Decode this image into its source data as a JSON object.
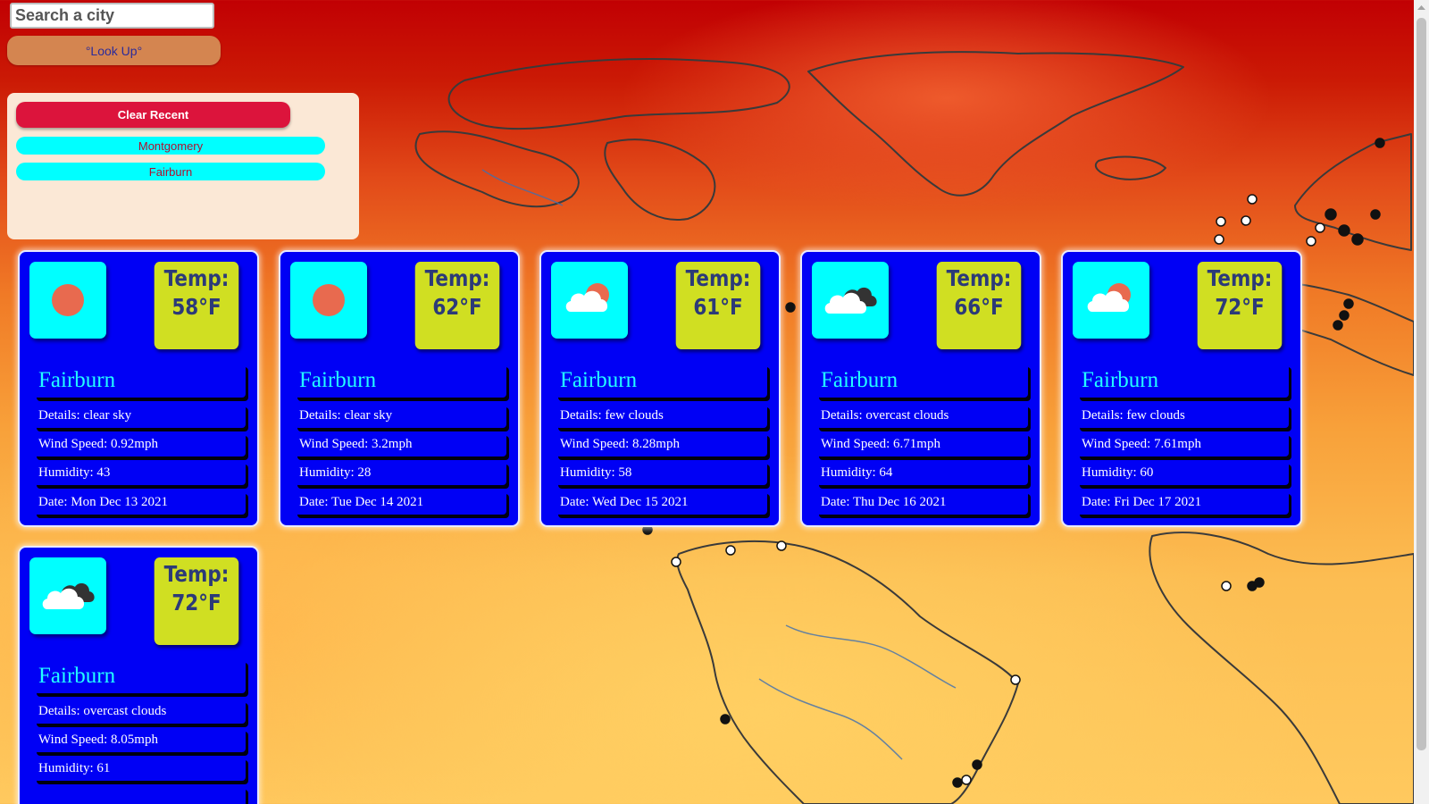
{
  "search": {
    "placeholder": "Search a city",
    "button_label": "°Look Up°"
  },
  "recent": {
    "clear_label": "Clear Recent",
    "cities": [
      "Montgomery",
      "Fairburn"
    ]
  },
  "forecast": [
    {
      "icon": "sun-icon",
      "temp_label": "Temp:",
      "temp": "58°F",
      "city": "Fairburn",
      "details": "Details: clear sky",
      "wind": "Wind Speed: 0.92mph",
      "humidity": "Humidity: 43",
      "date": "Date: Mon Dec 13 2021"
    },
    {
      "icon": "sun-icon",
      "temp_label": "Temp:",
      "temp": "62°F",
      "city": "Fairburn",
      "details": "Details: clear sky",
      "wind": "Wind Speed: 3.2mph",
      "humidity": "Humidity: 28",
      "date": "Date: Tue Dec 14 2021"
    },
    {
      "icon": "few-clouds-icon",
      "temp_label": "Temp:",
      "temp": "61°F",
      "city": "Fairburn",
      "details": "Details: few clouds",
      "wind": "Wind Speed: 8.28mph",
      "humidity": "Humidity: 58",
      "date": "Date: Wed Dec 15 2021"
    },
    {
      "icon": "overcast-clouds-icon",
      "temp_label": "Temp:",
      "temp": "66°F",
      "city": "Fairburn",
      "details": "Details: overcast clouds",
      "wind": "Wind Speed: 6.71mph",
      "humidity": "Humidity: 64",
      "date": "Date: Thu Dec 16 2021"
    },
    {
      "icon": "few-clouds-icon",
      "temp_label": "Temp:",
      "temp": "72°F",
      "city": "Fairburn",
      "details": "Details: few clouds",
      "wind": "Wind Speed: 7.61mph",
      "humidity": "Humidity: 60",
      "date": "Date: Fri Dec 17 2021"
    },
    {
      "icon": "overcast-clouds-icon",
      "temp_label": "Temp:",
      "temp": "72°F",
      "city": "Fairburn",
      "details": "Details: overcast clouds",
      "wind": "Wind Speed: 8.05mph",
      "humidity": "Humidity: 61",
      "date": ""
    }
  ],
  "colors": {
    "card_bg": "#0000f5",
    "icon_bg": "#00ffff",
    "temp_bg": "#d0df22",
    "clear_button": "#dc143c",
    "lookup_button": "#d48550",
    "recent_panel": "#fbe8d6"
  }
}
